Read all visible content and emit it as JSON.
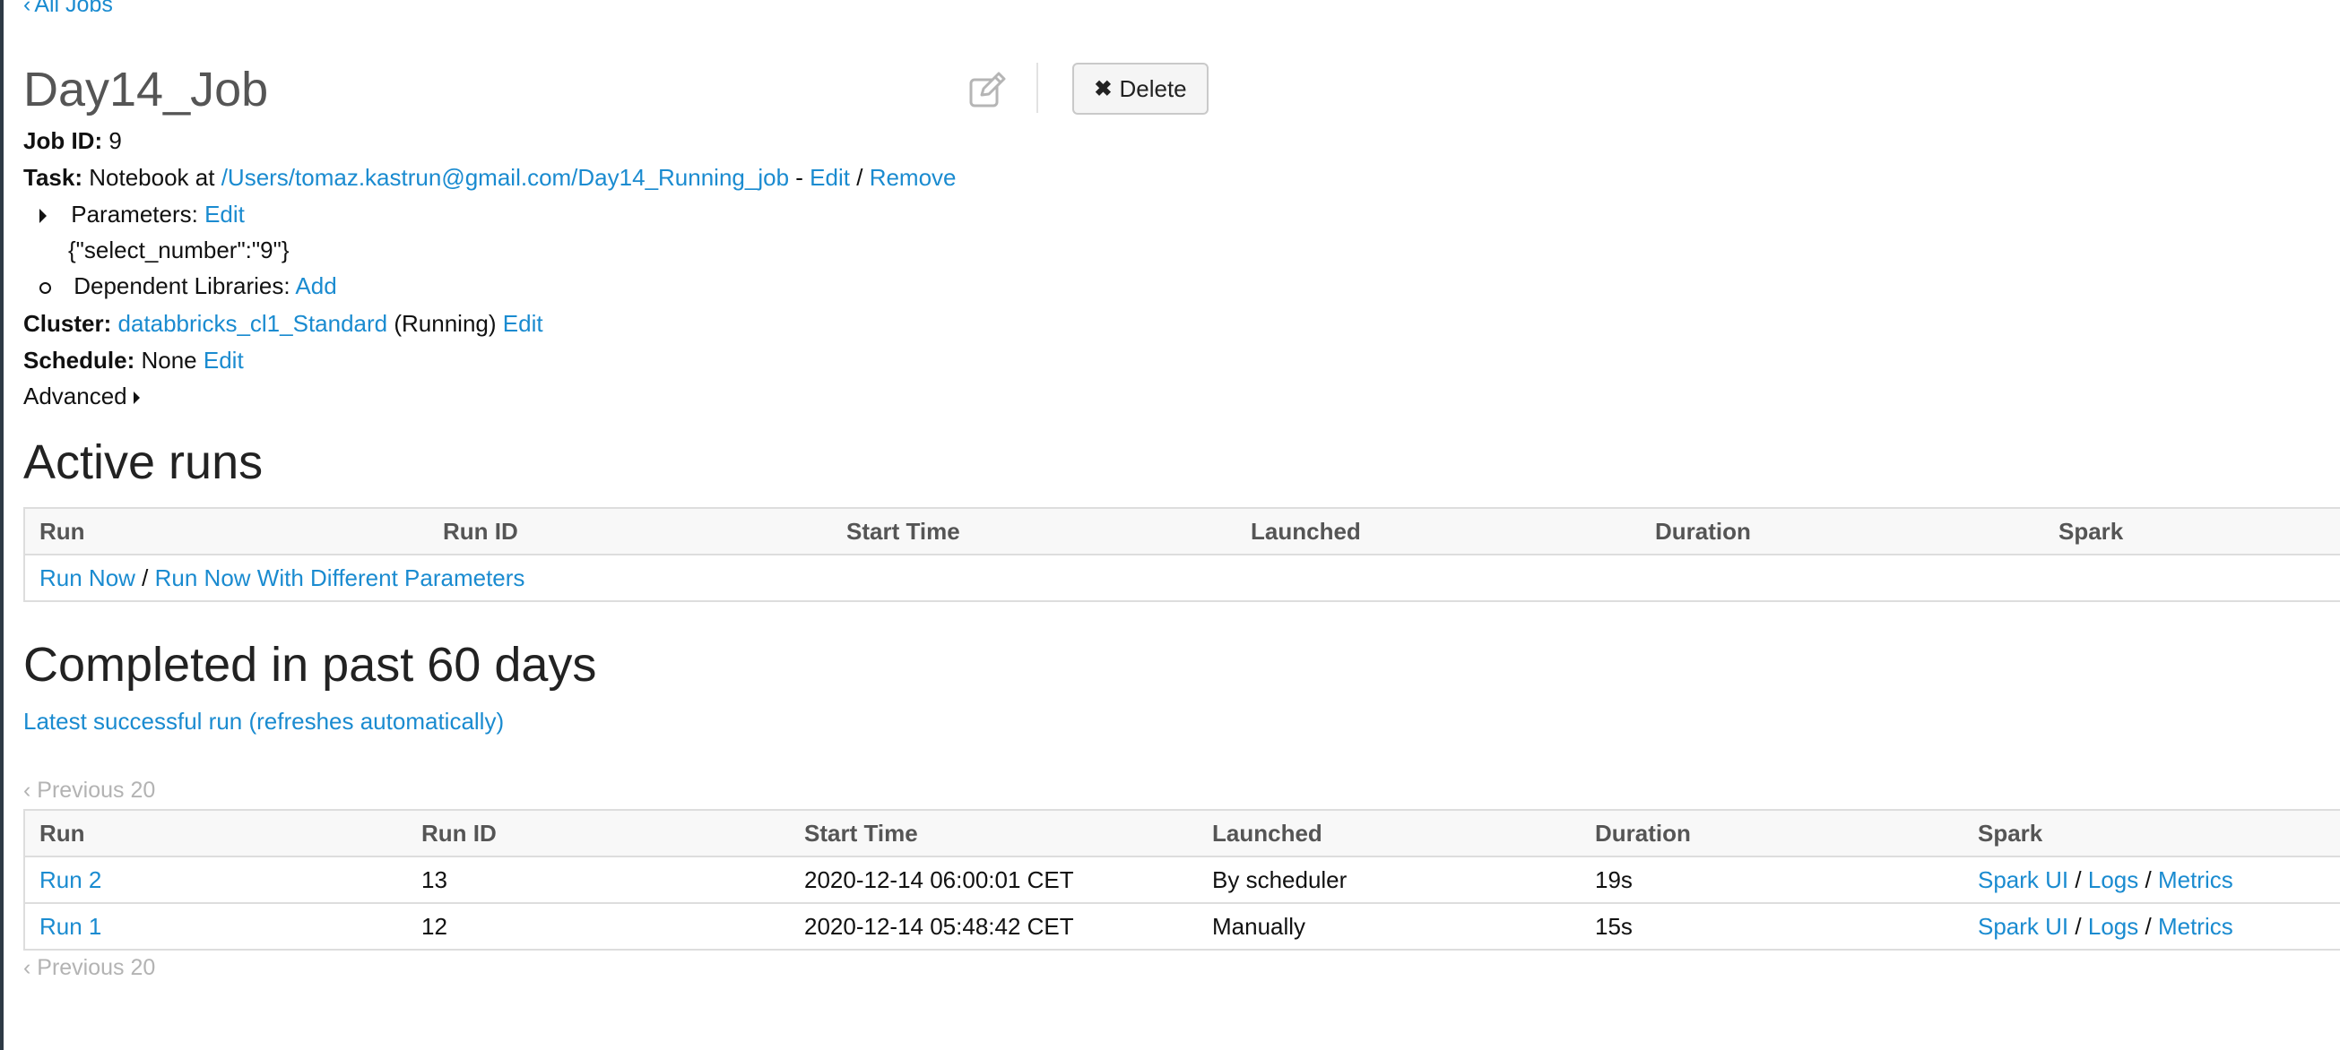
{
  "nav": {
    "back_label": "All Jobs",
    "back_chevron": "‹"
  },
  "job": {
    "title": "Day14_Job",
    "delete_label": "Delete",
    "job_id_label": "Job ID:",
    "job_id": "9",
    "task_label": "Task:",
    "task_prefix": "Notebook at",
    "notebook_path": "/Users/tomaz.kastrun@gmail.com/Day14_Running_job",
    "dash": "-",
    "edit": "Edit",
    "slash": "/",
    "remove": "Remove",
    "parameters_label": "Parameters:",
    "parameters_value": "{\"select_number\":\"9\"}",
    "dependent_libraries_label": "Dependent Libraries:",
    "add": "Add",
    "cluster_label": "Cluster:",
    "cluster_name": "databbricks_cl1_Standard",
    "cluster_status": "(Running)",
    "schedule_label": "Schedule:",
    "schedule_value": "None",
    "advanced_label": "Advanced"
  },
  "active_runs": {
    "heading": "Active runs",
    "columns": [
      "Run",
      "Run ID",
      "Start Time",
      "Launched",
      "Duration",
      "Spark"
    ],
    "run_now": "Run Now",
    "run_now_params": "Run Now With Different Parameters"
  },
  "completed": {
    "heading": "Completed in past 60 days",
    "latest_link": "Latest successful run (refreshes automatically)",
    "pager_label": "Previous 20",
    "columns": [
      "Run",
      "Run ID",
      "Start Time",
      "Launched",
      "Duration",
      "Spark"
    ],
    "rows": [
      {
        "run": "Run 2",
        "run_id": "13",
        "start_time": "2020-12-14 06:00:01 CET",
        "launched": "By scheduler",
        "duration": "19s",
        "spark_ui": "Spark UI",
        "logs": "Logs",
        "metrics": "Metrics"
      },
      {
        "run": "Run 1",
        "run_id": "12",
        "start_time": "2020-12-14 05:48:42 CET",
        "launched": "Manually",
        "duration": "15s",
        "spark_ui": "Spark UI",
        "logs": "Logs",
        "metrics": "Metrics"
      }
    ]
  },
  "colors": {
    "link": "#1a8bd0",
    "muted": "#b3b3b3",
    "sidebar": "#2d3a45"
  },
  "icons": {
    "edit": "pencil-square-icon",
    "delete": "close-x-icon",
    "expand": "caret-right-icon"
  }
}
